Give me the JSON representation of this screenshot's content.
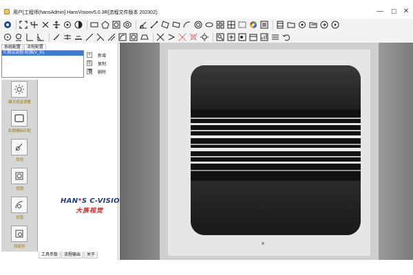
{
  "window": {
    "title": "用户[工程师(hansAdmin] HansVisionv5.0.3R[流程文件版本 202302]:",
    "minimize_glyph": "—",
    "maximize_glyph": "☐",
    "close_glyph": "✕"
  },
  "toolbar": {
    "row1_icons": [
      "camera-icon",
      "fit-icon",
      "zoom-in-icon",
      "zoom-out-icon",
      "pan-icon",
      "target-icon",
      "contrast-icon",
      "rectangle-icon",
      "pentagon-icon",
      "circle-roi-icon",
      "polygon-roi-icon",
      "measure-angle-icon",
      "line-tool-icon",
      "rotated-rect-icon",
      "rotated-rect-2-icon",
      "arc-icon",
      "ring-icon",
      "ellipse-icon",
      "grid-icon",
      "grid-2-icon",
      "grid-3-icon",
      "color-wheel-icon",
      "swatch-icon",
      "film-icon",
      "folder-icon",
      "settings-icon",
      "open-icon",
      "export-icon",
      "play-icon"
    ],
    "row2_icons": [
      "point-icon",
      "circle-point-icon",
      "corner-icon",
      "angle-icon",
      "ruler-icon",
      "parallel-icon",
      "bar-icon",
      "line-icon",
      "diagonal-icon",
      "diagonal-2-icon",
      "arc-measure-icon",
      "circle-measure-icon",
      "trapezoid-icon",
      "cross-icon",
      "chevron-icon",
      "dotted-cross-icon",
      "dotted-cross-2-icon",
      "light-icon",
      "zoom-icon",
      "loop-icon",
      "blob-icon",
      "calendar-icon",
      "chart-icon",
      "list-icon",
      "undo-icon"
    ]
  },
  "left_panel": {
    "tabs_top": [
      "系统配置",
      "流程配置"
    ],
    "flow_items": [
      "0:测试流程-轮廓(V_t0)"
    ],
    "flow_actions": [
      {
        "icon": "+",
        "label": "新增"
      },
      {
        "icon": "⎘",
        "label": "复制"
      },
      {
        "icon": "🗑",
        "label": "删除"
      }
    ],
    "tools": [
      {
        "label": "曝光增益调整",
        "icon": "sun-icon"
      },
      {
        "label": "轮廓模板匹配",
        "icon": "rect-template-icon"
      },
      {
        "label": "找线",
        "icon": "find-line-icon"
      },
      {
        "label": "找圆",
        "icon": "find-circle-icon"
      },
      {
        "label": "找弧",
        "icon": "find-arc-icon"
      },
      {
        "label": "找矩形",
        "icon": "find-rect-icon"
      }
    ],
    "logo_line1_a": "HAN",
    "logo_star": "*",
    "logo_line1_b": "S C-VISION",
    "logo_line2": "大族视觉",
    "tabs_bottom": [
      "工具参数",
      "流程输出",
      "关于"
    ]
  },
  "colors": {
    "selection": "#3b78d8",
    "tool_label": "#9c7a00",
    "brand_blue": "#1d3a8a",
    "brand_red": "#d21f1f"
  }
}
